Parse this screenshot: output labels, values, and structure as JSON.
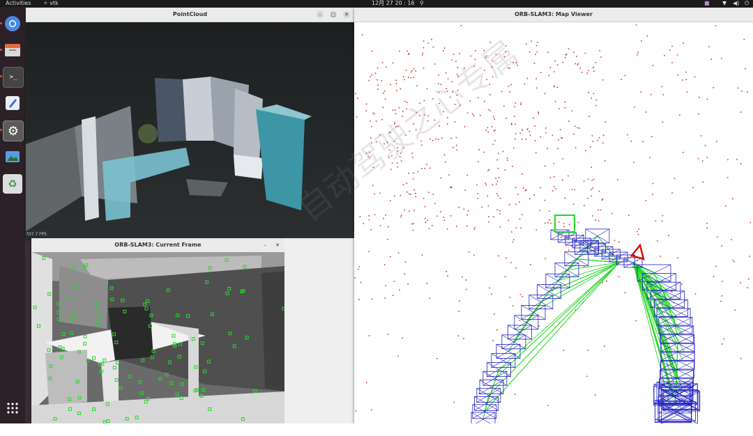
{
  "topbar": {
    "activities": "Activities",
    "app_name": "vtk",
    "datetime": "12月 27  20 : 16"
  },
  "windows": {
    "pointcloud": {
      "title": "PointCloud",
      "fps": "707.7 FPS"
    },
    "current_frame": {
      "title": "ORB-SLAM3: Current Frame"
    },
    "map_viewer": {
      "title": "ORB-SLAM3: Map Viewer"
    }
  },
  "dock": {
    "items": [
      {
        "name": "chromium",
        "icon": "browser-icon"
      },
      {
        "name": "files",
        "icon": "files-icon"
      },
      {
        "name": "terminal",
        "icon": "terminal-icon",
        "glyph": ">_"
      },
      {
        "name": "text-editor",
        "icon": "text-editor-icon"
      },
      {
        "name": "settings",
        "icon": "settings-icon",
        "glyph": "⚙"
      },
      {
        "name": "image-viewer",
        "icon": "image-viewer-icon"
      },
      {
        "name": "trash",
        "icon": "trash-icon",
        "glyph": "♻"
      }
    ],
    "apps_grid_icon": "apps-grid-icon"
  },
  "colors": {
    "map_points": "#c23b3b",
    "keyframes": "#1f1fc4",
    "graph_edges": "#22d922",
    "current_camera": "#d01010",
    "features": "#2ad62a"
  },
  "watermark": {
    "text": "自动驾驶之心专属"
  }
}
